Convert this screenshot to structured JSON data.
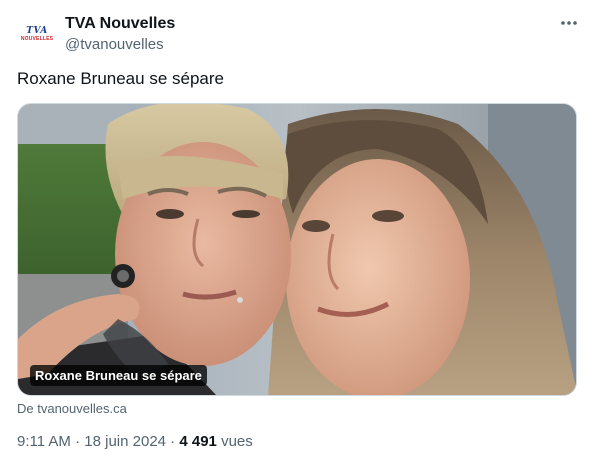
{
  "author": {
    "name": "TVA Nouvelles",
    "handle": "@tvanouvelles",
    "avatar_logo_top": "TVA",
    "avatar_logo_bottom": "NOUVELLES"
  },
  "tweet": {
    "text": "Roxane Bruneau se sépare"
  },
  "card": {
    "image_caption": "Roxane Bruneau se sépare",
    "source": "De tvanouvelles.ca"
  },
  "meta": {
    "time": "9:11 AM",
    "separator": " · ",
    "date": "18 juin 2024",
    "views_count": "4 491",
    "views_label": "vues"
  },
  "icons": {
    "more": "more-horizontal-icon"
  },
  "colors": {
    "text_primary": "#0f1419",
    "text_secondary": "#536471",
    "card_border": "#cfd9de",
    "logo_blue": "#1b3f8f",
    "logo_red": "#d21f2a"
  }
}
